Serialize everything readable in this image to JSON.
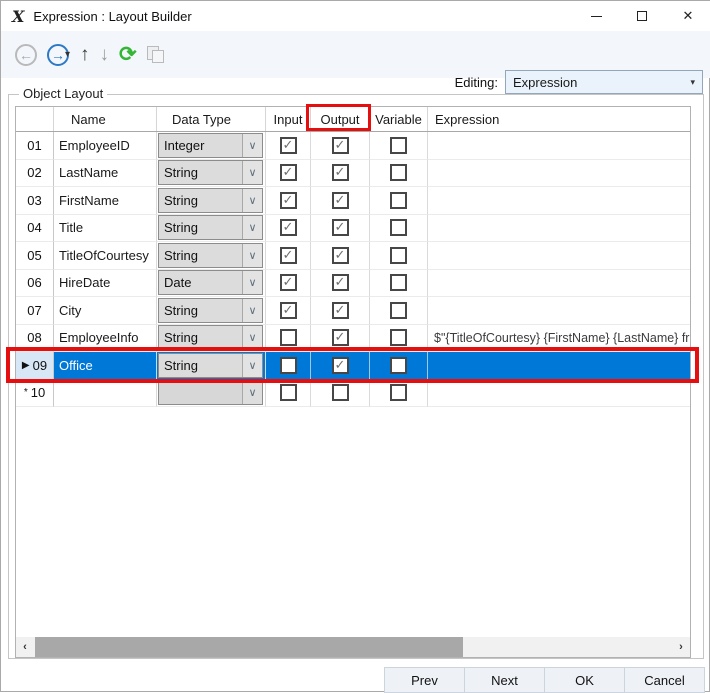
{
  "window": {
    "icon_glyph": "X",
    "title": "Expression : Layout Builder",
    "minimize": "minimize",
    "maximize": "maximize",
    "close": "close"
  },
  "toolbar": {
    "back_glyph": "←",
    "forward_glyph": "→",
    "dropdown_glyph": "▾",
    "up_glyph": "↑",
    "down_glyph": "↓",
    "refresh_glyph": "⟳",
    "editing_label": "Editing:",
    "editing_value": "Expression",
    "combo_arrow": "▾"
  },
  "groupbox": {
    "label": "Object Layout"
  },
  "grid": {
    "columns": [
      "",
      "Name",
      "Data Type",
      "Input",
      "Output",
      "Variable",
      "Expression"
    ],
    "highlighted_column": "Output",
    "combo_chevron": "∨",
    "check_glyph": "✓",
    "rows": [
      {
        "num": "01",
        "marker": "",
        "name": "EmployeeID",
        "type": "Integer",
        "input": true,
        "output": true,
        "variable": false,
        "expression": "",
        "selected": false,
        "new_row": false
      },
      {
        "num": "02",
        "marker": "",
        "name": "LastName",
        "type": "String",
        "input": true,
        "output": true,
        "variable": false,
        "expression": "",
        "selected": false,
        "new_row": false
      },
      {
        "num": "03",
        "marker": "",
        "name": "FirstName",
        "type": "String",
        "input": true,
        "output": true,
        "variable": false,
        "expression": "",
        "selected": false,
        "new_row": false
      },
      {
        "num": "04",
        "marker": "",
        "name": "Title",
        "type": "String",
        "input": true,
        "output": true,
        "variable": false,
        "expression": "",
        "selected": false,
        "new_row": false
      },
      {
        "num": "05",
        "marker": "",
        "name": "TitleOfCourtesy",
        "type": "String",
        "input": true,
        "output": true,
        "variable": false,
        "expression": "",
        "selected": false,
        "new_row": false
      },
      {
        "num": "06",
        "marker": "",
        "name": "HireDate",
        "type": "Date",
        "input": true,
        "output": true,
        "variable": false,
        "expression": "",
        "selected": false,
        "new_row": false
      },
      {
        "num": "07",
        "marker": "",
        "name": "City",
        "type": "String",
        "input": true,
        "output": true,
        "variable": false,
        "expression": "",
        "selected": false,
        "new_row": false
      },
      {
        "num": "08",
        "marker": "",
        "name": "EmployeeInfo",
        "type": "String",
        "input": false,
        "output": true,
        "variable": false,
        "expression": "$\"{TitleOfCourtesy} {FirstName} {LastName} fro",
        "selected": false,
        "new_row": false
      },
      {
        "num": "09",
        "marker": "▶",
        "name": "Office",
        "type": "String",
        "input": false,
        "output": true,
        "variable": false,
        "expression": "",
        "selected": true,
        "new_row": false
      },
      {
        "num": "10",
        "marker": "*",
        "name": "",
        "type": "",
        "input": false,
        "output": false,
        "variable": false,
        "expression": "",
        "selected": false,
        "new_row": true
      }
    ]
  },
  "scrollbar": {
    "left_glyph": "‹",
    "right_glyph": "›"
  },
  "buttons": [
    "Prev",
    "Next",
    "OK",
    "Cancel"
  ],
  "colors": {
    "selection_blue": "#0078d7",
    "annotation_red": "#e60f0f",
    "refresh_green": "#35b535",
    "forward_blue": "#2d79c5"
  }
}
